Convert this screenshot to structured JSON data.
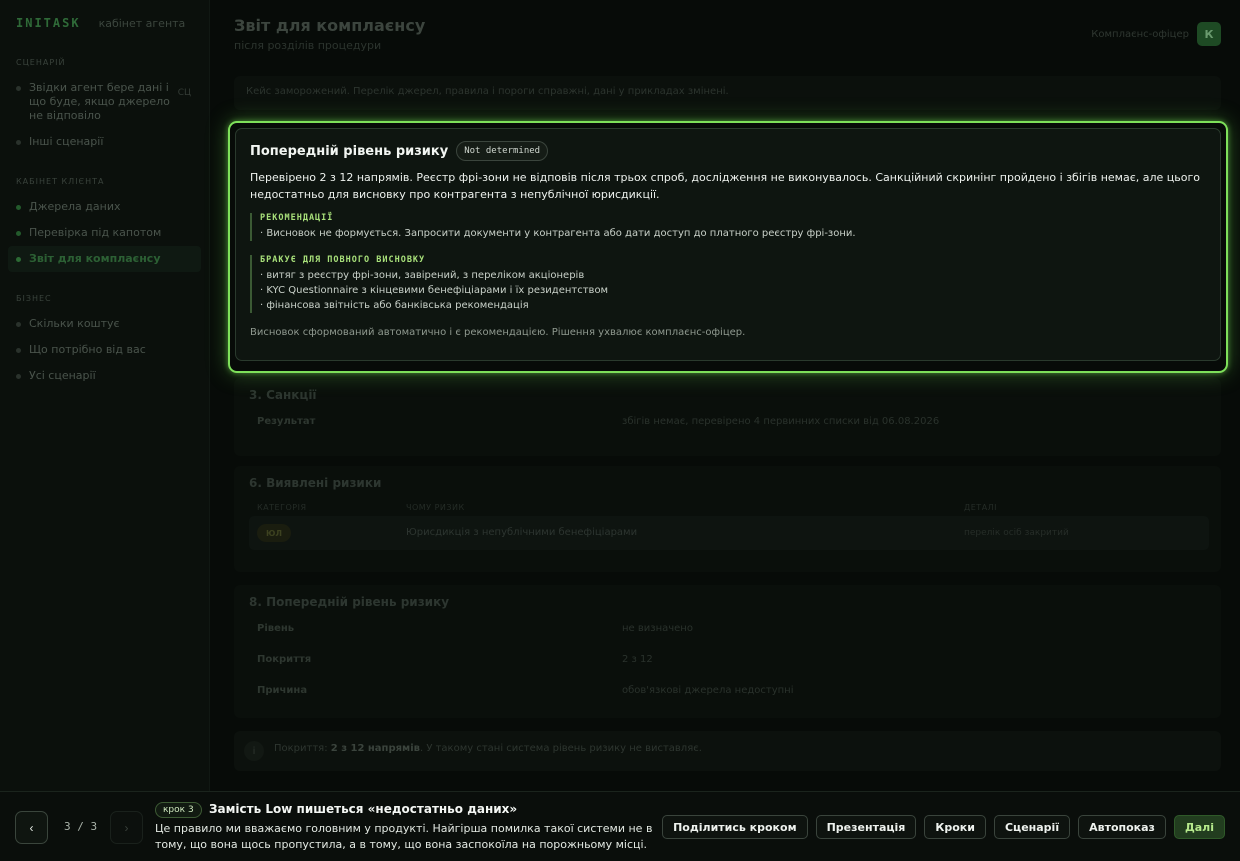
{
  "app": {
    "brand": "INITASK",
    "brand_sub": "кабінет агента"
  },
  "sidebar": {
    "sections": [
      {
        "title": "Сценарій",
        "items": [
          {
            "label": "Звідки агент бере дані і що буде, якщо джерело не відповіло",
            "tag": "СЦ"
          },
          {
            "label": "Інші сценарії"
          }
        ]
      },
      {
        "title": "Кабінет клієнта",
        "items": [
          {
            "label": "Джерела даних"
          },
          {
            "label": "Перевірка під капотом"
          },
          {
            "label": "Звіт для комплаєнсу"
          }
        ]
      },
      {
        "title": "Бізнес",
        "items": [
          {
            "label": "Скільки коштує"
          },
          {
            "label": "Що потрібно від вас"
          },
          {
            "label": "Усі сценарії"
          }
        ]
      }
    ]
  },
  "header": {
    "title": "Звіт для комплаєнсу",
    "subtitle": "після розділів процедури",
    "user_name": "Комплаєнс-офіцер",
    "avatar": "К"
  },
  "case_bar": "Кейс заморожений. Перелік джерел, правила і пороги справжні, дані у прикладах змінені.",
  "highlight": {
    "title": "Попередній рівень ризику",
    "badge": "Not determined",
    "text": "Перевірено 2 з 12 напрямів. Реєстр фрі-зони не відповів після трьох спроб, дослідження не виконувалось. Санкційний скринінг пройдено і збігів немає, але цього недостатньо для висновку про контрагента з непублічної юрисдикції.",
    "rec_title": "РЕКОМЕНДАЦІЇ",
    "rec_lines": [
      "· Висновок не формується. Запросити документи у контрагента або дати доступ до платного реєстру фрі-зони."
    ],
    "missing_title": "БРАКУЄ ДЛЯ ПОВНОГО ВИСНОВКУ",
    "missing_lines": [
      "· витяг з реєстру фрі-зони, завірений, з переліком акціонерів",
      "· KYC Questionnaire з кінцевими бенефіціарами і їх резидентством",
      "· фінансова звітність або банківська рекомендація"
    ],
    "footer": "Висновок сформований автоматично і є рекомендацією. Рішення ухвалює комплаєнс-офіцер."
  },
  "sanctions": {
    "title": "3. Санкції",
    "label": "Результат",
    "value": "збігів немає, перевірено 4 первинних списки від 06.08.2026"
  },
  "risks": {
    "title": "6. Виявлені ризики",
    "headers": [
      "Категорія",
      "Чому ризик",
      "Деталі"
    ],
    "row": {
      "chip": "ЮЛ",
      "reason": "Юрисдикція з непублічними бенефіціарами",
      "detail": "перелік осіб закритий"
    }
  },
  "level": {
    "title": "8. Попередній рівень ризику",
    "rows": [
      {
        "label": "Рівень",
        "value": "не визначено"
      },
      {
        "label": "Покриття",
        "value": "2 з 12"
      },
      {
        "label": "Причина",
        "value": "обов'язкові джерела недоступні"
      }
    ]
  },
  "info": {
    "icon": "i",
    "prefix": "Покриття: ",
    "bold": "2 з 12 напрямів",
    "suffix": ". У такому стані система рівень ризику не виставляє."
  },
  "tour": {
    "prev": "‹",
    "next": "›",
    "counter": "3 / 3",
    "step_chip": "крок 3",
    "step_title": "Замість Low пишеться «недостатньо даних»",
    "step_desc": "Це правило ми вважаємо головним у продукті. Найгірша помилка такої системи не в тому, що вона щось пропустила, а в тому, що вона заспокоїла на порожньому місці.",
    "buttons": {
      "share": "Поділитись кроком",
      "presentation": "Презентація",
      "steps": "Кроки",
      "scenarios": "Сценарії",
      "autoplay": "Автопоказ",
      "next": "Далі"
    }
  },
  "colors": {
    "accent": "#7ee05a",
    "background": "#070b08"
  }
}
